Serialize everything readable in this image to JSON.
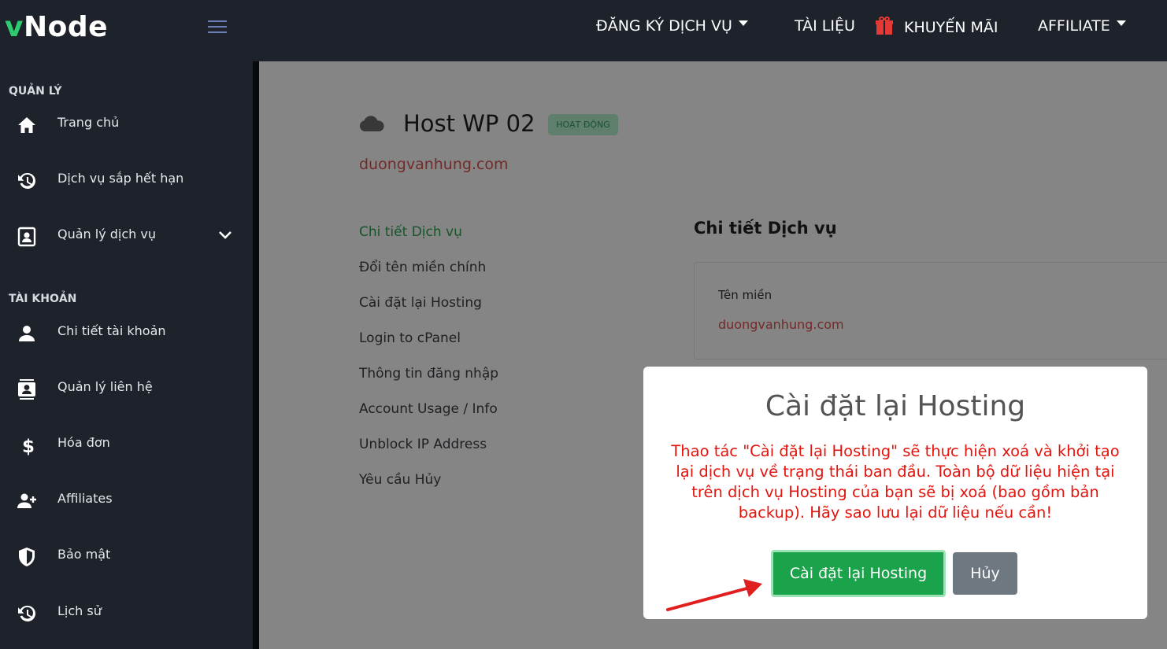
{
  "brand": {
    "logo_v": "v",
    "logo_rest": "Node"
  },
  "topnav": {
    "register": "ĐĂNG KÝ DỊCH VỤ",
    "docs": "TÀI LIỆU",
    "promo": "KHUYẾN MÃI",
    "affiliate": "AFFILIATE"
  },
  "sidebar": {
    "section_manage": "QUẢN LÝ",
    "section_account": "TÀI KHOẢN",
    "items": [
      {
        "label": "Trang chủ",
        "icon": "home-icon"
      },
      {
        "label": "Dịch vụ sắp hết hạn",
        "icon": "history-icon"
      },
      {
        "label": "Quản lý dịch vụ",
        "icon": "contact-card-icon"
      },
      {
        "label": "Chi tiết tài khoản",
        "icon": "user-icon"
      },
      {
        "label": "Quản lý liên hệ",
        "icon": "contacts-icon"
      },
      {
        "label": "Hóa đơn",
        "icon": "dollar-icon"
      },
      {
        "label": "Affiliates",
        "icon": "user-plus-icon"
      },
      {
        "label": "Bảo mật",
        "icon": "shield-icon"
      },
      {
        "label": "Lịch sử",
        "icon": "history-icon"
      }
    ]
  },
  "service": {
    "title": "Host WP 02",
    "status": "HOẠT ĐỘNG",
    "domain": "duongvanhung.com"
  },
  "service_menu": [
    "Chi tiết Dịch vụ",
    "Đổi tên miền chính",
    "Cài đặt lại Hosting",
    "Login to cPanel",
    "Thông tin đăng nhập",
    "Account Usage / Info",
    "Unblock IP Address",
    "Yêu cầu Hủy"
  ],
  "details": {
    "title": "Chi tiết Dịch vụ",
    "domain_label": "Tên miền",
    "domain_value": "duongvanhung.com"
  },
  "modal": {
    "title": "Cài đặt lại Hosting",
    "message": "Thao tác \"Cài đặt lại Hosting\" sẽ thực hiện xoá và khởi tạo lại dịch vụ về trạng thái ban đầu. Toàn bộ dữ liệu hiện tại trên dịch vụ Hosting của bạn sẽ bị xoá (bao gồm bản backup). Hãy sao lưu lại dữ liệu nếu cần!",
    "confirm": "Cài đặt lại Hosting",
    "cancel": "Hủy"
  },
  "colors": {
    "nav_bg": "#1d222b",
    "accent_green": "#1aa34a",
    "danger_red": "#e3150e",
    "link_red": "#d9534f",
    "arrow_red": "#e02020"
  }
}
